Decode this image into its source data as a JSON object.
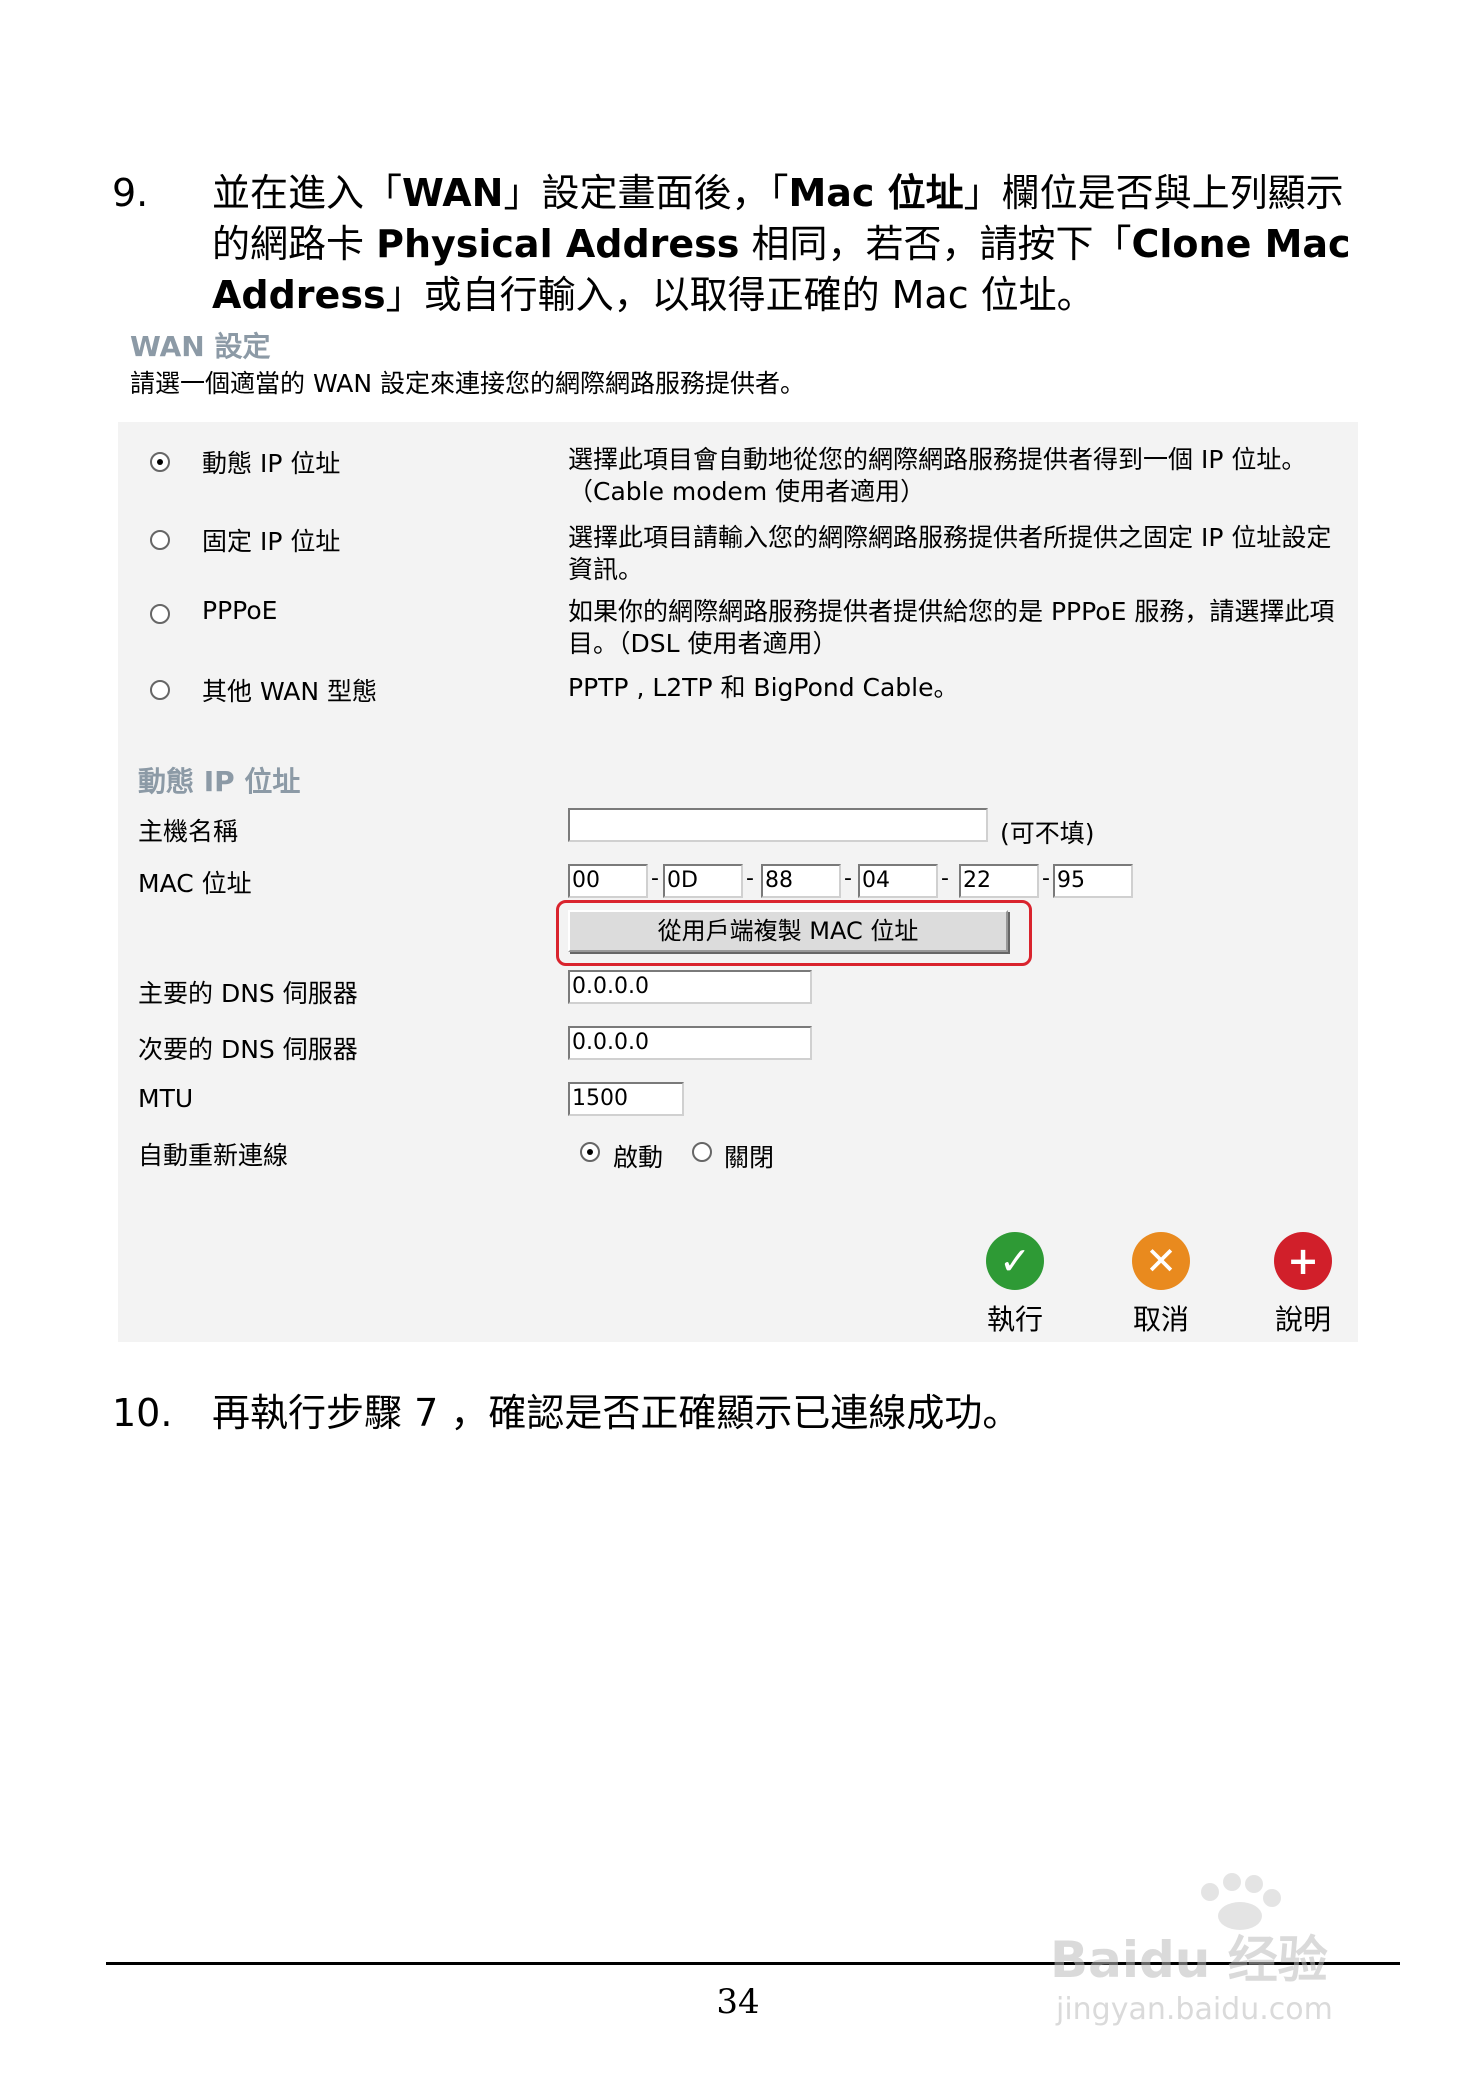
{
  "step9": {
    "num": "9.",
    "p1": "並在進入「",
    "b1": "WAN",
    "p2": "」設定畫面後，「",
    "b2": "Mac 位址",
    "p3": "」欄位是否與上列顯示的網路卡 ",
    "b3": "Physical Address",
    "p4": " 相同，若否，請按下「",
    "b4": "Clone Mac Address",
    "p5": "」或自行輸入，以取得正確的 Mac 位址。"
  },
  "wan": {
    "title": "WAN 設定",
    "description": "請選一個適當的 WAN 設定來連接您的網際網路服務提供者。",
    "options": [
      {
        "label": "動態 IP 位址",
        "desc": "選擇此項目會自動地從您的網際網路服務提供者得到一個 IP 位址。（Cable modem 使用者適用）",
        "selected": true
      },
      {
        "label": "固定 IP 位址",
        "desc": "選擇此項目請輸入您的網際網路服務提供者所提供之固定 IP 位址設定資訊。",
        "selected": false
      },
      {
        "label": "PPPoE",
        "desc": "如果你的網際網路服務提供者提供給您的是 PPPoE 服務，請選擇此項目。（DSL 使用者適用）",
        "selected": false
      },
      {
        "label": "其他 WAN 型態",
        "desc": "PPTP , L2TP 和 BigPond Cable。",
        "selected": false
      }
    ]
  },
  "dynamic": {
    "title": "動態 IP 位址",
    "hostname_label": "主機名稱",
    "hostname_value": "",
    "hostname_hint": "(可不填)",
    "mac_label": "MAC 位址",
    "mac": [
      "00",
      "0D",
      "88",
      "04",
      "22",
      "95"
    ],
    "clone_button": "從用戶端複製 MAC 位址",
    "dns1_label": "主要的 DNS 伺服器",
    "dns1_value": "0.0.0.0",
    "dns2_label": "次要的 DNS 伺服器",
    "dns2_value": "0.0.0.0",
    "mtu_label": "MTU",
    "mtu_value": "1500",
    "reconnect_label": "自動重新連線",
    "reconnect_on": "啟動",
    "reconnect_off": "關閉"
  },
  "actions": {
    "execute": "執行",
    "cancel": "取消",
    "help": "說明"
  },
  "step10": {
    "num": "10.",
    "text": "再執行步驟 7 ，確認是否正確顯示已連線成功。"
  },
  "page_number": "34",
  "watermark": {
    "brand": "Baidu 经验",
    "url": "jingyan.baidu.com"
  },
  "colors": {
    "highlight": "#d9232d",
    "execute": "#2e9a35",
    "cancel": "#e98a1e",
    "help": "#d11f2a",
    "section_title": "#8c9aa6"
  }
}
